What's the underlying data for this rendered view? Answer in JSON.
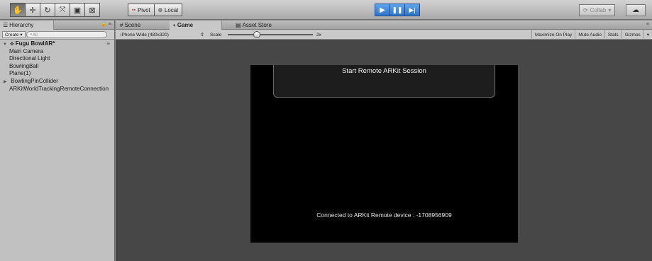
{
  "toolbar": {
    "tools": [
      {
        "icon": "hand-icon",
        "glyph": "✋",
        "active": true
      },
      {
        "icon": "move-icon",
        "glyph": "✛",
        "active": false
      },
      {
        "icon": "rotate-icon",
        "glyph": "↻",
        "active": false
      },
      {
        "icon": "scale-icon",
        "glyph": "⤧",
        "active": false
      },
      {
        "icon": "rect-tool-icon",
        "glyph": "▣",
        "active": false
      },
      {
        "icon": "transform-icon",
        "glyph": "⊠",
        "active": false
      }
    ],
    "pivot_label": "Pivot",
    "local_label": "Local",
    "collab_label": "Collab",
    "playback": {
      "play_icon": "play-icon",
      "pause_icon": "pause-icon",
      "step_icon": "step-icon"
    }
  },
  "hierarchy": {
    "tab_label": "Hierarchy",
    "create_label": "Create",
    "search_placeholder": "All",
    "scene_name": "Fugu BowlAR*",
    "items": [
      {
        "label": "Main Camera",
        "foldable": false
      },
      {
        "label": "Directional Light",
        "foldable": false
      },
      {
        "label": "BowlingBall",
        "foldable": false
      },
      {
        "label": "Plane(1)",
        "foldable": false
      },
      {
        "label": "BowlingPinCollider",
        "foldable": true
      },
      {
        "label": "ARKitWorldTrackingRemoteConnection",
        "foldable": false
      }
    ]
  },
  "game_panel": {
    "tabs": [
      {
        "label": "Scene",
        "active": false
      },
      {
        "label": "Game",
        "active": true
      },
      {
        "label": "Asset Store",
        "active": false
      }
    ],
    "resolution": "iPhone Wide (480x320)",
    "scale_label": "Scale",
    "scale_value": "2x",
    "options": [
      "Maximize On Play",
      "Mute Audio",
      "Stats",
      "Gizmos"
    ],
    "viewport": {
      "button_label": "Start Remote ARKit Session",
      "status_text": "Connected to ARKit Remote device : -1708956909"
    }
  },
  "colors": {
    "play_active": "#3c82d8",
    "viewport_bg": "#000000",
    "game_bg": "#474747"
  }
}
